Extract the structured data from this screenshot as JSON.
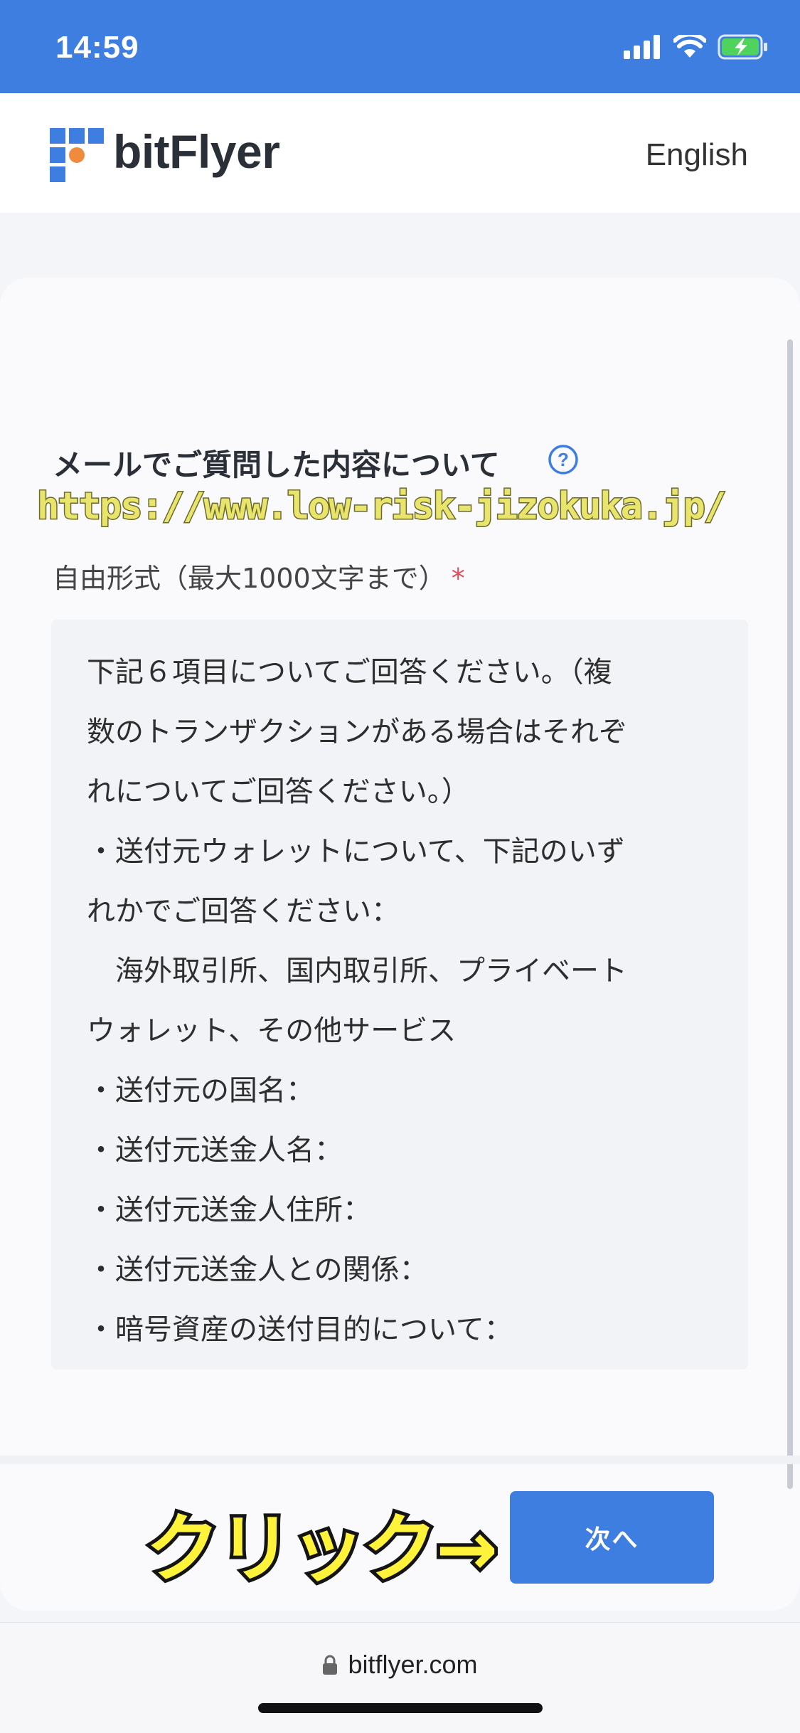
{
  "status_bar": {
    "time": "14:59"
  },
  "header": {
    "brand": "bitFlyer",
    "language_link": "English"
  },
  "form": {
    "title": "メールでご質問した内容について",
    "subtitle": "自由形式（最大1000文字まで）",
    "required_mark": "*",
    "textarea_lines": [
      "下記６項目についてご回答ください。（複",
      "数のトランザクションがある場合はそれぞ",
      "れについてご回答ください。）",
      "・送付元ウォレットについて、下記のいず",
      "れかでご回答ください：",
      "　海外取引所、国内取引所、プライベート",
      "ウォレット、その他サービス",
      "・送付元の国名：",
      "・送付元送金人名：",
      "・送付元送金人住所：",
      "・送付元送金人との関係：",
      "・暗号資産の送付目的について："
    ],
    "next_button": "次へ"
  },
  "overlays": {
    "watermark_url": "https://www.low-risk-jizokuka.jp/",
    "click_annotation": "クリック→"
  },
  "browser": {
    "url": "bitflyer.com"
  },
  "colors": {
    "brand_blue": "#3d7ee0",
    "logo_orange": "#f08a3c",
    "required_red": "#e04d5a",
    "annotation_yellow": "#fff23a"
  },
  "icons": {
    "signal": "cellular-signal-icon",
    "wifi": "wifi-icon",
    "battery": "battery-charging-icon",
    "help": "question-circle-icon",
    "lock": "lock-icon"
  }
}
